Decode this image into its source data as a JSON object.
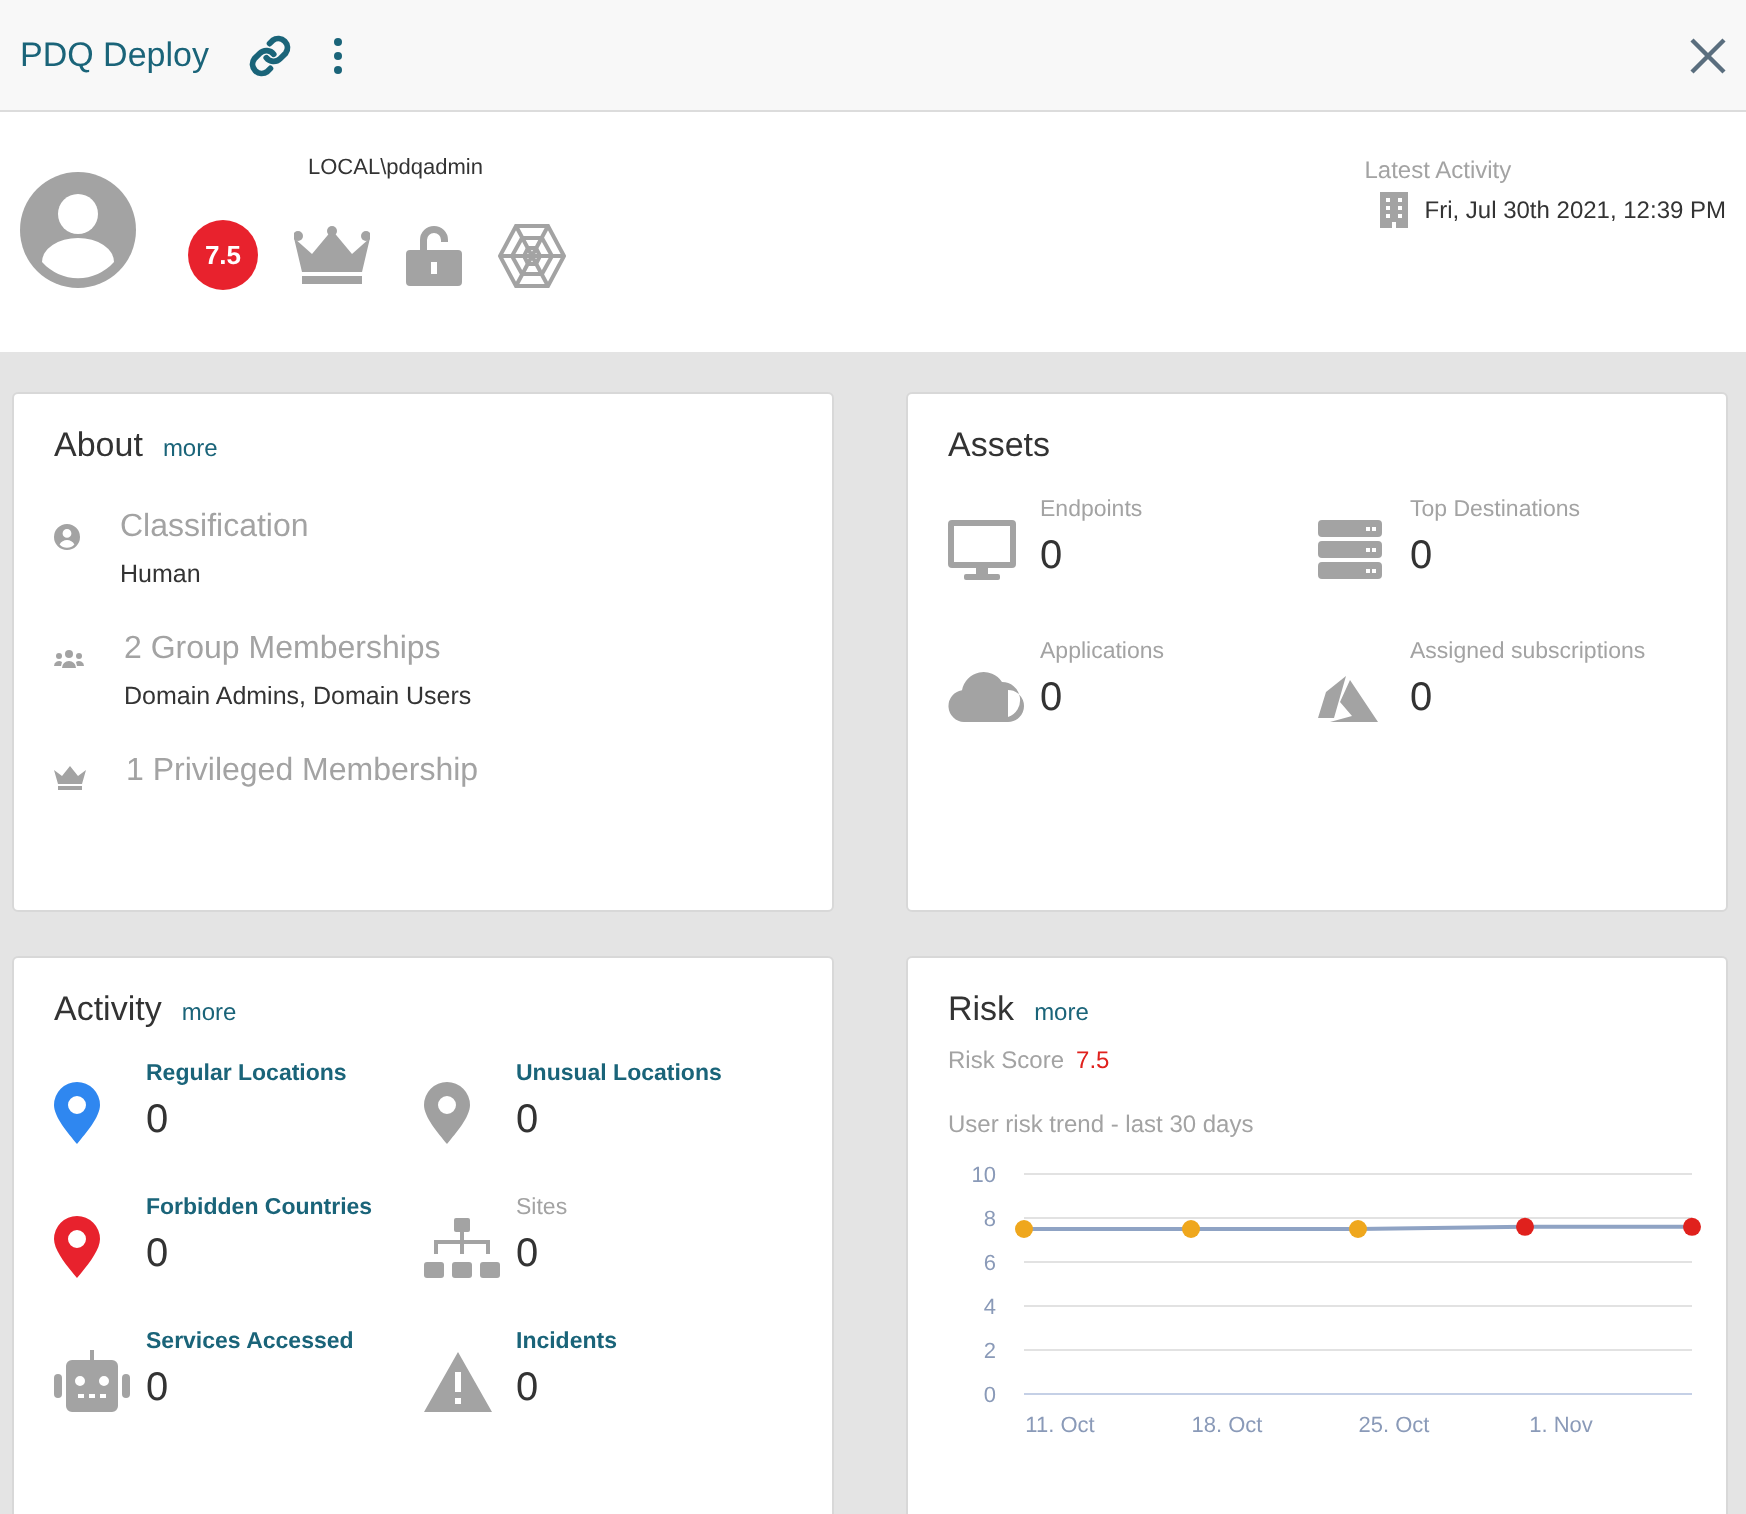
{
  "header": {
    "title": "PDQ Deploy"
  },
  "profile": {
    "account": "LOCAL\\pdqadmin",
    "risk_badge": "7.5",
    "latest_activity_label": "Latest Activity",
    "latest_activity": "Fri, Jul 30th 2021, 12:39 PM"
  },
  "about": {
    "title": "About",
    "more": "more",
    "items": [
      {
        "label": "Classification",
        "value": "Human"
      },
      {
        "label": "2 Group Memberships",
        "value": "Domain Admins, Domain Users"
      },
      {
        "label": "1 Privileged Membership"
      }
    ]
  },
  "assets": {
    "title": "Assets",
    "items": [
      {
        "label": "Endpoints",
        "value": "0"
      },
      {
        "label": "Top Destinations",
        "value": "0"
      },
      {
        "label": "Applications",
        "value": "0"
      },
      {
        "label": "Assigned subscriptions",
        "value": "0"
      }
    ]
  },
  "activity": {
    "title": "Activity",
    "more": "more",
    "items": [
      {
        "label": "Regular Locations",
        "value": "0",
        "linked": true,
        "color": "#2f87f0"
      },
      {
        "label": "Unusual Locations",
        "value": "0",
        "linked": true,
        "color": "#a0a0a0"
      },
      {
        "label": "Forbidden Countries",
        "value": "0",
        "linked": true,
        "color": "#e8222d"
      },
      {
        "label": "Sites",
        "value": "0",
        "linked": false
      },
      {
        "label": "Services Accessed",
        "value": "0",
        "linked": true
      },
      {
        "label": "Incidents",
        "value": "0",
        "linked": true
      }
    ]
  },
  "risk": {
    "title": "Risk",
    "more": "more",
    "score_label": "Risk Score",
    "score": "7.5",
    "trend_label": "User risk trend - last 30 days",
    "chart_data": {
      "type": "line",
      "grid": true,
      "categories": [
        "11. Oct",
        "18. Oct",
        "25. Oct",
        "1. Nov",
        null
      ],
      "ylim": [
        0,
        10
      ],
      "yticks": [
        0,
        2,
        4,
        6,
        8,
        10
      ],
      "series": [
        {
          "color": "#8fa3c4",
          "values": [
            7.5,
            7.5,
            7.5,
            7.6,
            7.6
          ],
          "marker": "circle"
        }
      ]
    },
    "trend_points": [
      {
        "color": "#efa71d"
      },
      {
        "color": "#efa71d"
      },
      {
        "color": "#efa71d"
      },
      {
        "color": "#e0211d"
      },
      {
        "color": "#e0211d"
      }
    ]
  }
}
